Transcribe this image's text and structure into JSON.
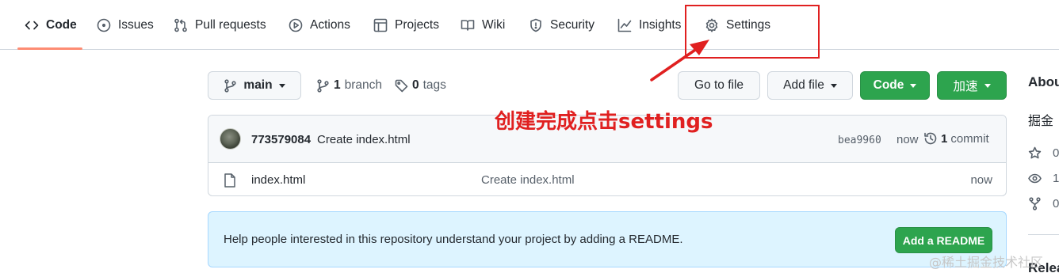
{
  "tabs": [
    {
      "label": "Code",
      "icon": "code-icon",
      "selected": true
    },
    {
      "label": "Issues",
      "icon": "issue-opened-icon"
    },
    {
      "label": "Pull requests",
      "icon": "git-pull-request-icon"
    },
    {
      "label": "Actions",
      "icon": "play-icon"
    },
    {
      "label": "Projects",
      "icon": "table-icon"
    },
    {
      "label": "Wiki",
      "icon": "book-icon"
    },
    {
      "label": "Security",
      "icon": "shield-icon"
    },
    {
      "label": "Insights",
      "icon": "graph-icon"
    },
    {
      "label": "Settings",
      "icon": "gear-icon"
    }
  ],
  "toolbar": {
    "branch_select": "main",
    "branch_count": "1",
    "branch_label": "branch",
    "tag_count": "0",
    "tag_label": "tags",
    "go_to_file": "Go to file",
    "add_file": "Add file",
    "code": "Code",
    "accelerate": "加速"
  },
  "annotation": {
    "text": "创建完成点击settings",
    "color": "#e02020"
  },
  "commit": {
    "author": "773579084",
    "message": "Create index.html",
    "sha": "bea9960",
    "time": "now",
    "count": "1",
    "count_label": "commit"
  },
  "files": [
    {
      "name": "index.html",
      "commit_message": "Create index.html",
      "time": "now"
    }
  ],
  "readme_banner": {
    "text": "Help people interested in this repository understand your project by adding a README.",
    "button": "Add a README"
  },
  "sidebar": {
    "about_title": "Abou",
    "description": "掘金",
    "stars": "0",
    "watchers": "1",
    "forks": "0",
    "releases_title": "Relea"
  },
  "watermark": "@稀土掘金技术社区",
  "colors": {
    "accent_green": "#2da44e",
    "tab_underline": "#fd8c73",
    "readme_bg": "#ddf4ff",
    "annotation_red": "#e02020"
  }
}
